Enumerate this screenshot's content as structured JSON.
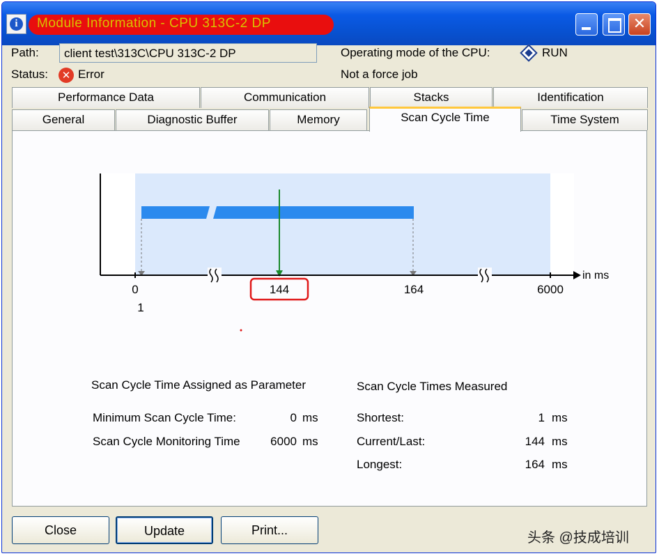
{
  "window": {
    "title": "Module Information - CPU 313C-2 DP"
  },
  "header": {
    "path_label": "Path:",
    "path_value": "client test\\313C\\CPU 313C-2 DP",
    "status_label": "Status:",
    "status_value": "Error",
    "status_icon": "error-x-icon",
    "opmode_label": "Operating mode of the  CPU:",
    "opmode_value": "RUN",
    "opmode_icon": "run-diamond-icon",
    "force_job": "Not a force job"
  },
  "tabs": {
    "row1": [
      "Performance Data",
      "Communication",
      "Stacks",
      "Identification"
    ],
    "row2": [
      "General",
      "Diagnostic Buffer",
      "Memory",
      "Scan Cycle Time",
      "Time System"
    ],
    "active": "Scan Cycle Time"
  },
  "chart_data": {
    "type": "timeline",
    "unit_label": "in ms",
    "axis_ticks": [
      "0",
      "144",
      "164",
      "6000"
    ],
    "min_marker_label": "1",
    "shortest_ms": 1,
    "current_ms": 144,
    "longest_ms": 164,
    "min_assigned_ms": 0,
    "max_monitoring_ms": 6000,
    "colors": {
      "range_band": "#dbe9fc",
      "bar": "#2b8aee",
      "current_line": "#1a8a2a",
      "highlight": "#e01818"
    }
  },
  "assigned": {
    "heading": "Scan Cycle Time Assigned as Parameter",
    "rows": [
      {
        "label": "Minimum Scan Cycle Time:",
        "value": "0",
        "unit": "ms"
      },
      {
        "label": "Scan Cycle Monitoring Time",
        "value": "6000",
        "unit": "ms"
      }
    ]
  },
  "measured": {
    "heading": "Scan Cycle Times Measured",
    "rows": [
      {
        "label": "Shortest:",
        "value": "1",
        "unit": "ms"
      },
      {
        "label": "Current/Last:",
        "value": "144",
        "unit": "ms"
      },
      {
        "label": "Longest:",
        "value": "164",
        "unit": "ms"
      }
    ]
  },
  "buttons": {
    "close": "Close",
    "update": "Update",
    "print": "Print..."
  },
  "watermark": "头条 @技成培训"
}
